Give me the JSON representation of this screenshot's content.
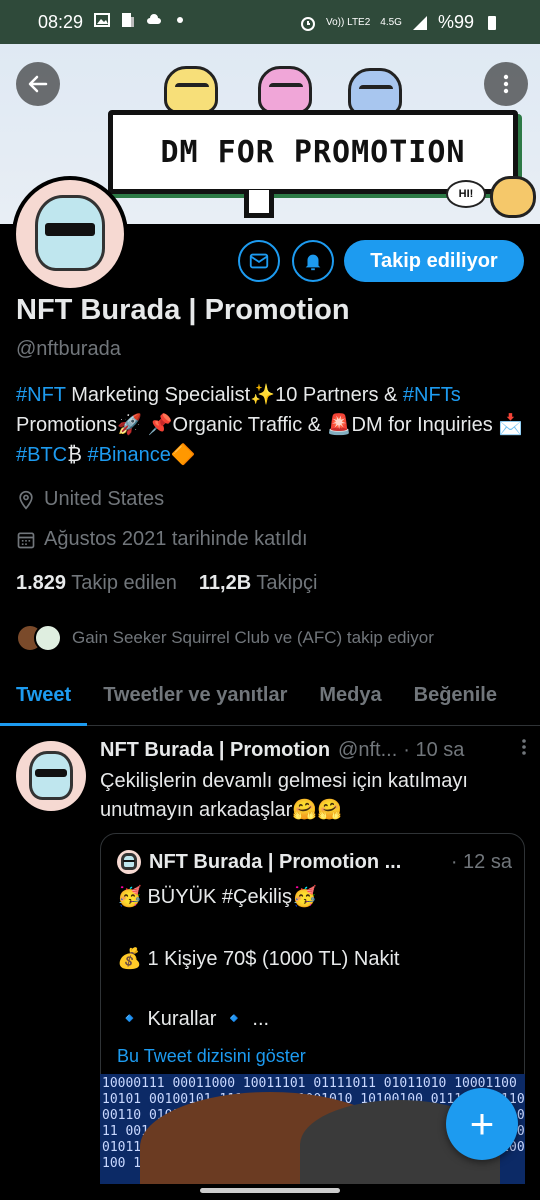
{
  "status_bar": {
    "time": "08:29",
    "network_label": "Vo)) LTE2",
    "signal_label": "4.5G",
    "battery": "%99"
  },
  "banner": {
    "promo_text": "DM FOR PROMOTION",
    "bubble_text": "HI!"
  },
  "profile": {
    "name": "NFT Burada | Promotion",
    "handle": "@nftburada",
    "bio_parts": {
      "nft_tag": "#NFT",
      "p1": " Marketing Specialist✨10 Partners & ",
      "nfts_tag": "#NFTs",
      "p2": " Promotions🚀  📌Organic Traffic & 🚨DM for Inquiries 📩 ",
      "btc_tag": "#BTC",
      "p3": "₿  ",
      "binance_tag": "#Binance",
      "p4": "🔶"
    },
    "location": "United States",
    "joined": "Ağustos 2021 tarihinde katıldı",
    "following_count": "1.829",
    "following_label": "Takip edilen",
    "followers_count": "11,2B",
    "followers_label": "Takipçi",
    "followed_by": "Gain Seeker Squirrel Club ve (AFC) takip ediyor",
    "follow_button": "Takip ediliyor"
  },
  "tabs": [
    "Tweet",
    "Tweetler ve yanıtlar",
    "Medya",
    "Beğenile"
  ],
  "tweet": {
    "name": "NFT Burada | Promotion",
    "handle": "@nft...",
    "time": "· 10 sa",
    "text": "Çekilişlerin devamlı gelmesi için katılmayı unutmayın arkadaşlar🤗🤗",
    "quote": {
      "name": "NFT Burada | Promotion ...",
      "time": "· 12 sa",
      "line1": "🥳 BÜYÜK #Çekiliş🥳",
      "line2": "💰 1 Kişiye 70$ (1000 TL) Nakit",
      "line3": "🔹 Kurallar 🔹 ...",
      "show_thread": "Bu Tweet dizisini göster",
      "binary_text": "10000111 00011000 10011101 01111011 01011010 10001100 10101 00100101 11110000 11001010 10100100 01111010 11000110 01011 10011100 01110101 11000110 10110011 01001011 00111010 1100 01101010 10011100 01011010 11000111 00101101 10100101 0101 01011110 10101001 01010101 11100100 10101010 01001110 10100"
    }
  },
  "fab_label": "+",
  "colors": {
    "accent": "#1d9bf0",
    "muted": "#71767b",
    "status_bar": "#2f4a3a"
  }
}
